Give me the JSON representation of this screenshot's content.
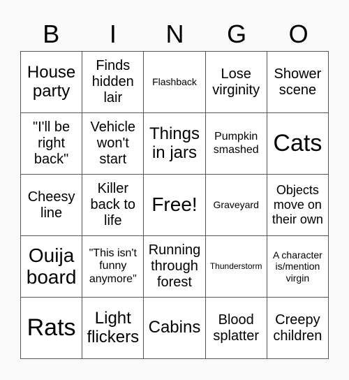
{
  "header": [
    "B",
    "I",
    "N",
    "G",
    "O"
  ],
  "cells": [
    [
      "House party",
      "Finds hidden lair",
      "Flashback",
      "Lose virginity",
      "Shower scene"
    ],
    [
      "\"I'll be right back\"",
      "Vehicle won't start",
      "Things in jars",
      "Pumpkin smashed",
      "Cats"
    ],
    [
      "Cheesy line",
      "Killer back to life",
      "Free!",
      "Graveyard",
      "Objects move on their own"
    ],
    [
      "Ouija board",
      "\"This isn't funny anymore\"",
      "Running through forest",
      "Thunderstorm",
      "A character is/mention virgin"
    ],
    [
      "Rats",
      "Light flickers",
      "Cabins",
      "Blood splatter",
      "Creepy children"
    ]
  ],
  "free_space": {
    "row": 2,
    "col": 2
  }
}
